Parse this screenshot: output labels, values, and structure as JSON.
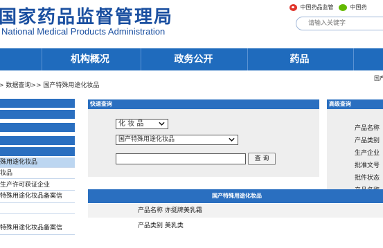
{
  "header": {
    "logo_cn": "国家药品监督管理局",
    "logo_en": "National Medical Products Administration",
    "weibo_label": "中国药品监管",
    "wechat_label": "中国药",
    "search_placeholder": "请输入关键字"
  },
  "nav": {
    "items": [
      "",
      "机构概况",
      "政务公开",
      "药品",
      ""
    ]
  },
  "breadcrumb": {
    "text": "> 数据查询>> 国产特殊用途化妆品",
    "right_fragment": "国产"
  },
  "sidebar": {
    "items": [
      {
        "label": "殊用途化妆品",
        "active": true
      },
      {
        "label": "妆品",
        "active": false
      },
      {
        "label": "生产许可获证企业",
        "active": false
      },
      {
        "label": "特殊用途化妆品备案信",
        "active": false
      },
      {
        "label": "",
        "active": false
      },
      {
        "label": "特殊用途化妆品备案信",
        "active": false
      }
    ]
  },
  "quick_search": {
    "title": "快速查询",
    "type_select_value": "化 妆 品",
    "category_select_value": "国产特殊用途化妆品",
    "keyword_value": "",
    "search_button": "查 询"
  },
  "advanced_search": {
    "title": "高级查询",
    "items": [
      "产品名称",
      "产品类别",
      "生产企业",
      "批准文号",
      "批件状态",
      "产品名称"
    ]
  },
  "results": {
    "title": "国产特殊用途化妆品",
    "rows": [
      "产品名称 亦挺牌美乳霜",
      "产品类别 美乳类"
    ]
  }
}
